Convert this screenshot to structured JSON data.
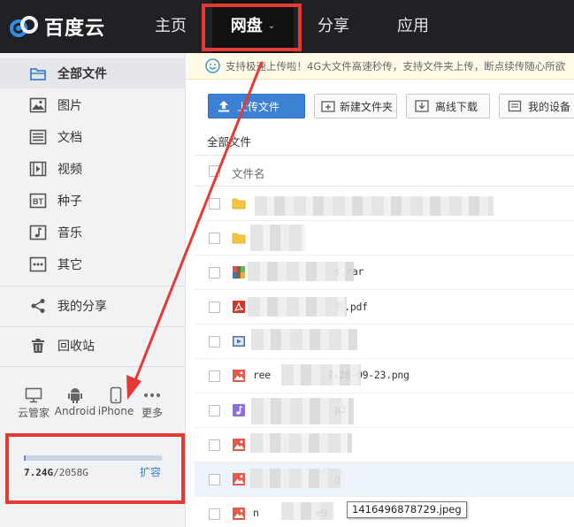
{
  "app": {
    "brand": "百度云",
    "nav": [
      {
        "label": "主页"
      },
      {
        "label": "网盘",
        "active": true
      },
      {
        "label": "分享"
      },
      {
        "label": "应用"
      }
    ]
  },
  "sidebar": {
    "items": [
      {
        "label": "全部文件",
        "icon": "folder-icon",
        "active": true
      },
      {
        "label": "图片",
        "icon": "image-icon"
      },
      {
        "label": "文档",
        "icon": "document-icon"
      },
      {
        "label": "视频",
        "icon": "video-icon"
      },
      {
        "label": "种子",
        "icon": "bt-icon"
      },
      {
        "label": "音乐",
        "icon": "music-icon"
      },
      {
        "label": "其它",
        "icon": "other-icon"
      },
      {
        "label": "我的分享",
        "icon": "share-icon"
      },
      {
        "label": "回收站",
        "icon": "trash-icon"
      }
    ],
    "bt_glyph": "BT",
    "devices": [
      {
        "label": "云管家",
        "icon": "monitor-icon"
      },
      {
        "label": "Android",
        "icon": "android-icon"
      },
      {
        "label": "iPhone",
        "icon": "iphone-icon"
      },
      {
        "label": "更多",
        "icon": "more-icon"
      }
    ],
    "storage": {
      "used": "7.24G",
      "separator": "/",
      "total": "2058G",
      "fraction": 0.0035,
      "expand_label": "扩容"
    }
  },
  "main": {
    "notice": "支持极速上传啦！4G大文件高速秒传，支持文件夹上传，断点续传随心所欲",
    "toolbar": {
      "upload": "上传文件",
      "new_folder": "新建文件夹",
      "offline": "离线下载",
      "devices": "我的设备"
    },
    "breadcrumb": "全部文件",
    "column_name": "文件名",
    "files": [
      {
        "type": "folder",
        "prefix": "",
        "suffix": ""
      },
      {
        "type": "folder",
        "prefix": "",
        "suffix": ""
      },
      {
        "type": "rar",
        "prefix": "",
        "suffix": "s.rar"
      },
      {
        "type": "pdf",
        "prefix": "",
        "suffix": "书.pdf"
      },
      {
        "type": "video",
        "prefix": "",
        "suffix": ""
      },
      {
        "type": "image",
        "prefix": "ree",
        "suffix": "7-20-09-23.png"
      },
      {
        "type": "music",
        "prefix": "",
        "suffix": "p3"
      },
      {
        "type": "image",
        "prefix": "",
        "suffix": ""
      },
      {
        "type": "image",
        "prefix": "",
        "suffix": "g"
      },
      {
        "type": "image",
        "prefix": "n",
        "suffix": "e9"
      }
    ],
    "tooltip": "1416496878729.jpeg"
  },
  "colors": {
    "topbar": "#1f2124",
    "accent": "#3b82d4",
    "annotation": "#e53935"
  }
}
